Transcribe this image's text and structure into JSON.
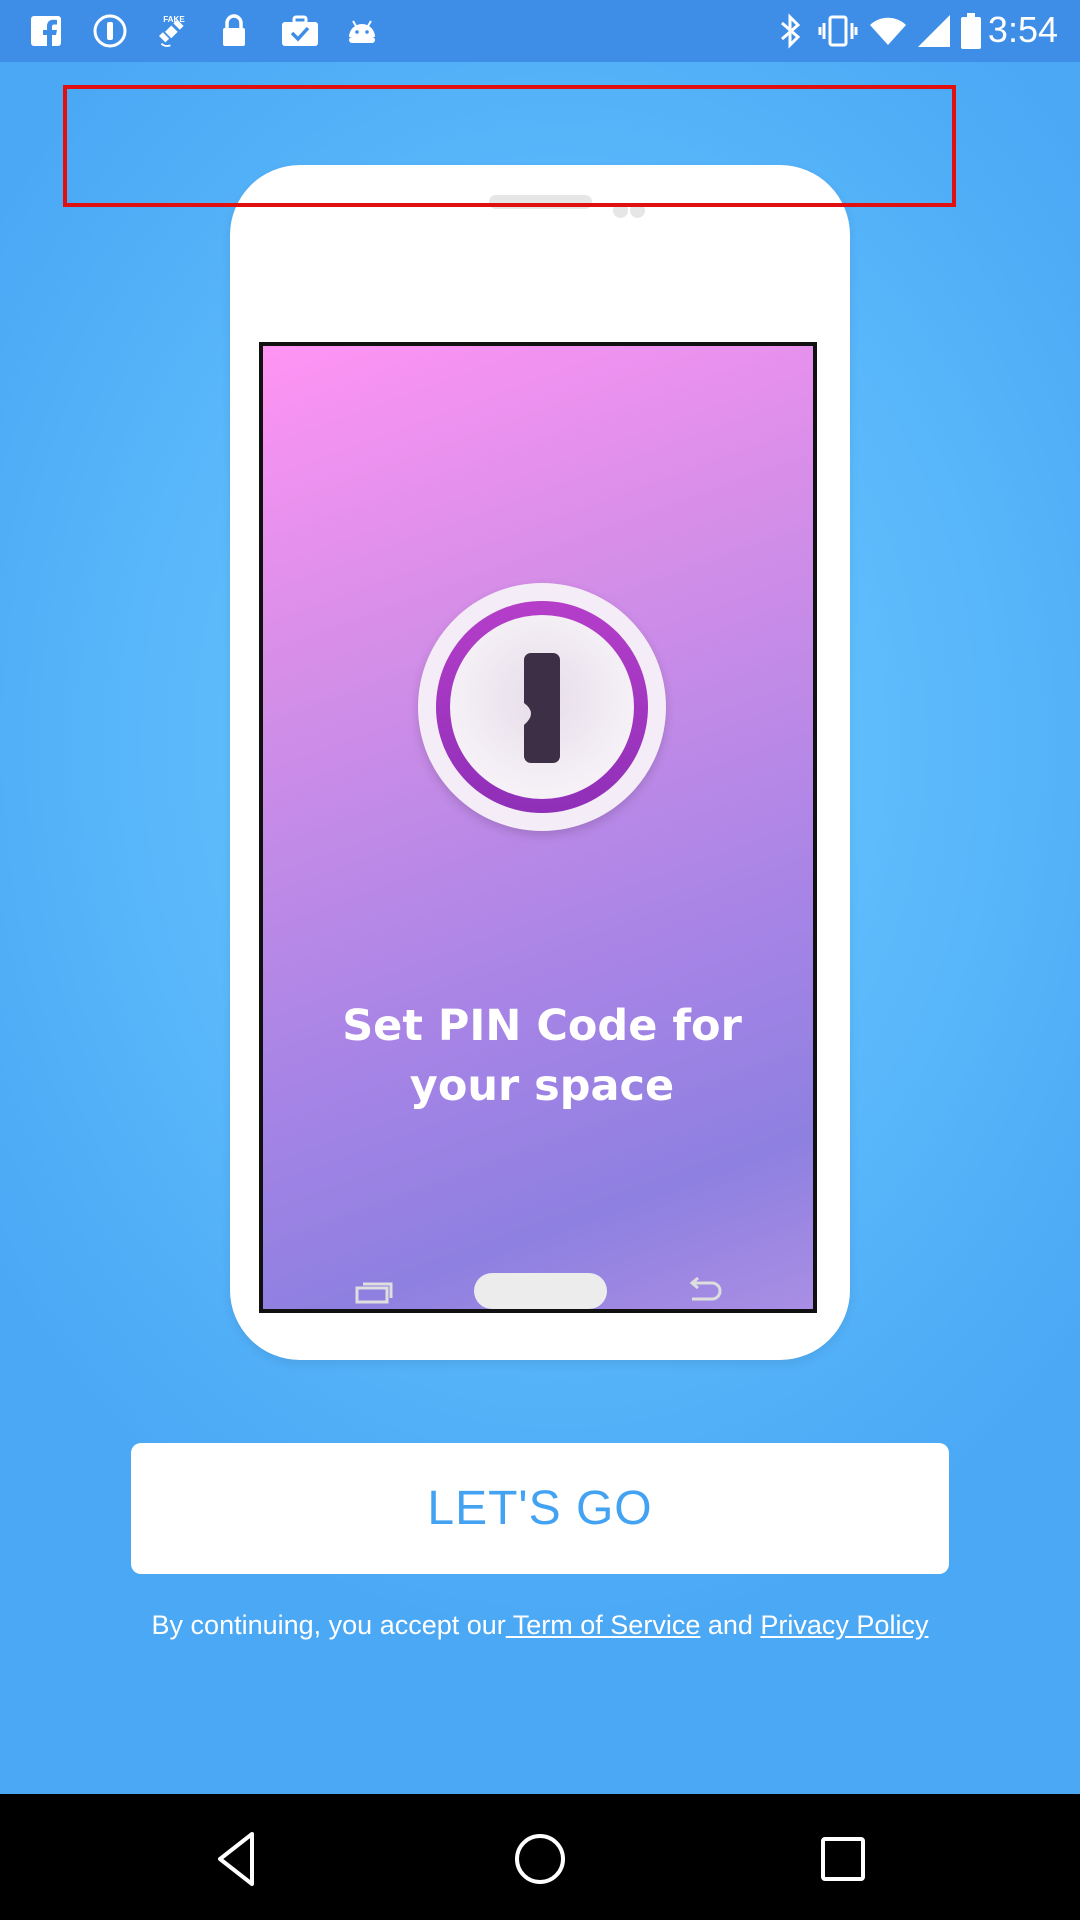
{
  "status_bar": {
    "time": "3:54",
    "left_icons": [
      "facebook-icon",
      "security-shield-icon",
      "fake-gps-satellite-icon",
      "lock-icon",
      "briefcase-check-icon",
      "android-icon"
    ],
    "right_icons": [
      "bluetooth-icon",
      "vibrate-icon",
      "wifi-icon",
      "signal-icon",
      "battery-icon"
    ]
  },
  "onboarding": {
    "screen_title": "Set PIN Code for your space",
    "logo_icon": "keyhole-logo-icon",
    "highlight_color": "#e01010"
  },
  "actions": {
    "letsgo_label": "LET'S GO"
  },
  "legal": {
    "prefix": "By continuing, you accept our",
    "terms_link": " Term of Service",
    "conjunction": " and ",
    "privacy_link": "Privacy Policy"
  },
  "nav_bar": {
    "buttons": [
      "back-icon",
      "home-icon",
      "recents-icon"
    ]
  },
  "colors": {
    "accent": "#43a3f2",
    "background": "#5ebcfc",
    "status_bar": "#3e8ee8"
  }
}
